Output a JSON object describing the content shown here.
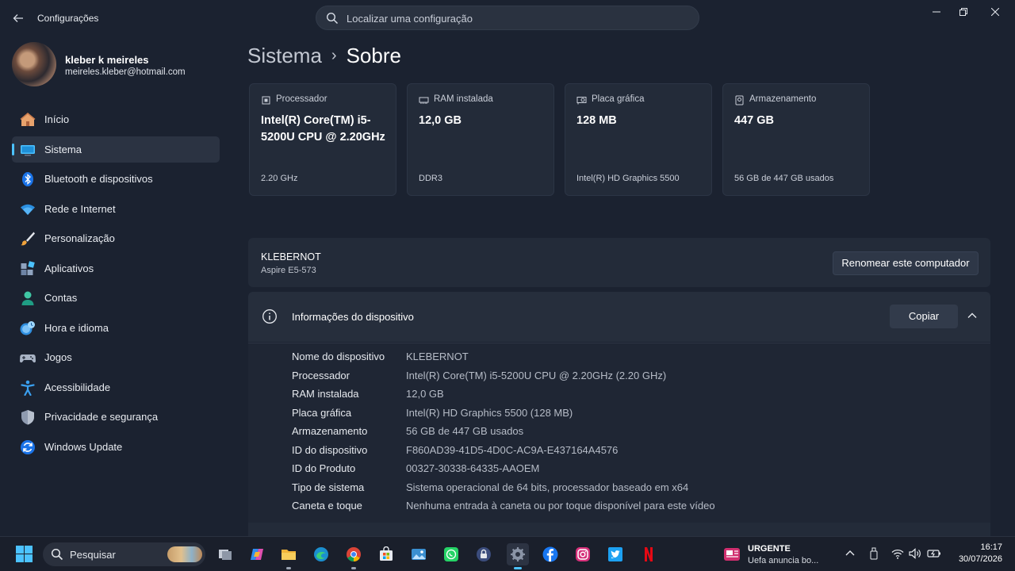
{
  "window": {
    "app_title": "Configurações",
    "search_placeholder": "Localizar uma configuração"
  },
  "profile": {
    "name": "kleber k meireles",
    "email": "meireles.kleber@hotmail.com"
  },
  "sidebar": {
    "items": [
      {
        "label": "Início",
        "icon": "home-icon"
      },
      {
        "label": "Sistema",
        "icon": "system-icon",
        "active": true
      },
      {
        "label": "Bluetooth e dispositivos",
        "icon": "bluetooth-icon"
      },
      {
        "label": "Rede e Internet",
        "icon": "wifi-icon"
      },
      {
        "label": "Personalização",
        "icon": "brush-icon"
      },
      {
        "label": "Aplicativos",
        "icon": "apps-icon"
      },
      {
        "label": "Contas",
        "icon": "account-icon"
      },
      {
        "label": "Hora e idioma",
        "icon": "clock-globe-icon"
      },
      {
        "label": "Jogos",
        "icon": "gamepad-icon"
      },
      {
        "label": "Acessibilidade",
        "icon": "accessibility-icon"
      },
      {
        "label": "Privacidade e segurança",
        "icon": "shield-icon"
      },
      {
        "label": "Windows Update",
        "icon": "update-icon"
      }
    ]
  },
  "breadcrumb": {
    "parent": "Sistema",
    "separator": "›",
    "current": "Sobre"
  },
  "spec_cards": [
    {
      "title": "Processador",
      "value": "Intel(R) Core(TM) i5-5200U CPU @ 2.20GHz",
      "sub": "2.20 GHz",
      "icon": "processor-icon"
    },
    {
      "title": "RAM instalada",
      "value": "12,0 GB",
      "sub": "DDR3",
      "icon": "ram-icon"
    },
    {
      "title": "Placa gráfica",
      "value": "128 MB",
      "sub": "Intel(R) HD Graphics 5500",
      "icon": "gpu-icon"
    },
    {
      "title": "Armazenamento",
      "value": "447 GB",
      "sub": "56 GB de 447 GB usados",
      "icon": "storage-icon"
    }
  ],
  "computer": {
    "name": "KLEBERNOT",
    "model": "Aspire E5-573",
    "rename_label": "Renomear este computador"
  },
  "device_info": {
    "title": "Informações do dispositivo",
    "copy_label": "Copiar",
    "rows": [
      {
        "key": "Nome do dispositivo",
        "value": "KLEBERNOT"
      },
      {
        "key": "Processador",
        "value": "Intel(R) Core(TM) i5-5200U CPU @ 2.20GHz (2.20 GHz)"
      },
      {
        "key": "RAM instalada",
        "value": "12,0 GB"
      },
      {
        "key": "Placa gráfica",
        "value": "Intel(R) HD Graphics 5500 (128 MB)"
      },
      {
        "key": "Armazenamento",
        "value": "56 GB de 447 GB usados"
      },
      {
        "key": "ID do dispositivo",
        "value": "F860AD39-41D5-4D0C-AC9A-E437164A4576"
      },
      {
        "key": "ID do Produto",
        "value": "00327-30338-64335-AAOEM"
      },
      {
        "key": "Tipo de sistema",
        "value": "Sistema operacional de 64 bits, processador baseado em x64"
      },
      {
        "key": "Caneta e toque",
        "value": "Nenhuma entrada à caneta ou por toque disponível para este vídeo"
      }
    ]
  },
  "taskbar": {
    "search_label": "Pesquisar",
    "apps": [
      "task-view-icon",
      "copilot-icon",
      "file-explorer-icon",
      "edge-icon",
      "chrome-icon",
      "store-icon",
      "photos-icon",
      "whatsapp-icon",
      "vpn-lock-icon",
      "settings-icon",
      "facebook-icon",
      "instagram-icon",
      "twitter-icon",
      "netflix-icon"
    ],
    "news_title": "URGENTE",
    "news_text": "Uefa anuncia bo...",
    "time": "16:17",
    "date": "30/07/2026"
  },
  "colors": {
    "background": "#1b2230",
    "accent": "#4cc2ff",
    "card": "#232b39"
  }
}
